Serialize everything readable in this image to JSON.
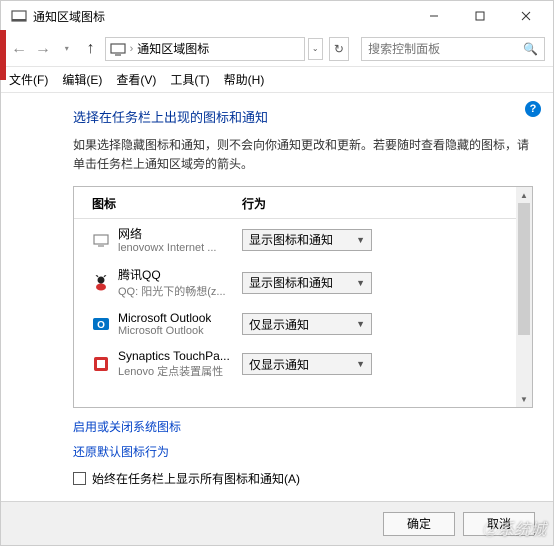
{
  "window": {
    "title": "通知区域图标"
  },
  "addressbar": {
    "text": "通知区域图标"
  },
  "search": {
    "placeholder": "搜索控制面板"
  },
  "menubar": {
    "file": "文件(F)",
    "edit": "编辑(E)",
    "view": "查看(V)",
    "tools": "工具(T)",
    "help": "帮助(H)"
  },
  "content": {
    "heading": "选择在任务栏上出现的图标和通知",
    "description": "如果选择隐藏图标和通知，则不会向你通知更改和更新。若要随时查看隐藏的图标，请单击任务栏上通知区域旁的箭头。",
    "col_icon": "图标",
    "col_action": "行为",
    "items": [
      {
        "title": "网络",
        "subtitle": "lenovowx Internet ...",
        "action": "显示图标和通知",
        "icon_color": "#888"
      },
      {
        "title": "腾讯QQ",
        "subtitle": "QQ: 阳光下的畅想(z...",
        "action": "显示图标和通知",
        "icon_color": "#000"
      },
      {
        "title": "Microsoft Outlook",
        "subtitle": "Microsoft Outlook",
        "action": "仅显示通知",
        "icon_color": "#0072c6"
      },
      {
        "title": "Synaptics TouchPa...",
        "subtitle": "Lenovo 定点装置属性",
        "action": "仅显示通知",
        "icon_color": "#d32f2f"
      }
    ],
    "link1": "启用或关闭系统图标",
    "link2": "还原默认图标行为",
    "checkbox_label": "始终在任务栏上显示所有图标和通知(A)"
  },
  "footer": {
    "ok": "确定",
    "cancel": "取消"
  }
}
